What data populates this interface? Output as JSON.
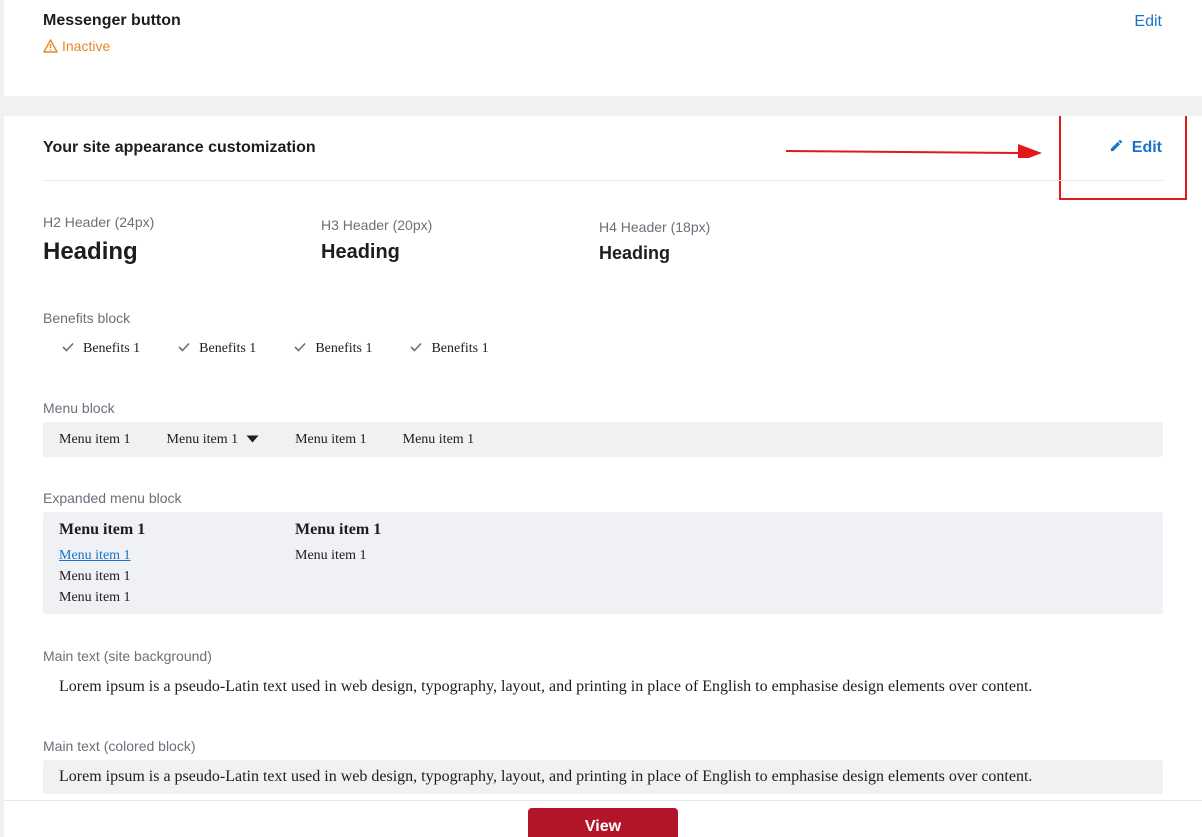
{
  "messenger": {
    "title": "Messenger button",
    "status": "Inactive",
    "status_color": "#e8862a",
    "status_icon": "warning-icon",
    "edit_label": "Edit"
  },
  "appearance": {
    "title": "Your site appearance customization",
    "edit_label": "Edit",
    "edit_icon": "pencil-icon",
    "accent": "#1a73c8",
    "annotation_color": "#e11919",
    "headers": [
      {
        "label": "H2 Header (24px)",
        "text": "Heading"
      },
      {
        "label": "H3 Header (20px)",
        "text": "Heading"
      },
      {
        "label": "H4 Header (18px)",
        "text": "Heading"
      }
    ],
    "benefits": {
      "label": "Benefits block",
      "items": [
        "Benefits 1",
        "Benefits 1",
        "Benefits 1",
        "Benefits 1"
      ]
    },
    "menu": {
      "label": "Menu block",
      "items": [
        "Menu item 1",
        "Menu item 1",
        "Menu item 1",
        "Menu item 1"
      ]
    },
    "expanded_menu": {
      "label": "Expanded menu block",
      "columns": [
        {
          "heading": "Menu item 1",
          "link": "Menu item 1",
          "items": [
            "Menu item 1",
            "Menu item 1"
          ]
        },
        {
          "heading": "Menu item 1",
          "items": [
            "Menu item 1"
          ]
        }
      ]
    },
    "main_text_site": {
      "label": "Main text (site background)",
      "text": "Lorem ipsum is a pseudo-Latin text used in web design, typography, layout, and printing in place of English to emphasise design elements over content."
    },
    "main_text_colored": {
      "label": "Main text (colored block)",
      "text": "Lorem ipsum is a pseudo-Latin text used in web design, typography, layout, and printing in place of English to emphasise design elements over content."
    }
  },
  "footer": {
    "view_label": "View",
    "view_color": "#b3152a"
  }
}
